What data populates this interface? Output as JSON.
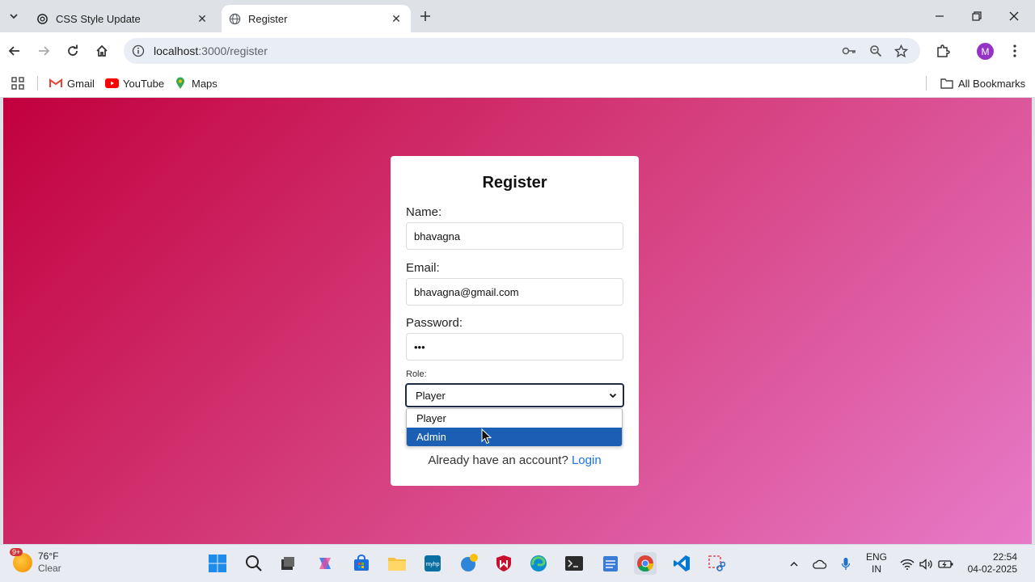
{
  "tabs": [
    {
      "title": "CSS Style Update",
      "active": false
    },
    {
      "title": "Register",
      "active": true
    }
  ],
  "toolbar": {
    "url_host": "localhost",
    "url_path": ":3000/register"
  },
  "profile": {
    "initial": "M"
  },
  "bookmarks": {
    "items": [
      "Gmail",
      "YouTube",
      "Maps"
    ],
    "all_label": "All Bookmarks"
  },
  "form": {
    "title": "Register",
    "name_label": "Name:",
    "name_value": "bhavagna",
    "email_label": "Email:",
    "email_value": "bhavagna@gmail.com",
    "password_label": "Password:",
    "password_value": "•••",
    "role_label": "Role:",
    "role_selected": "Player",
    "role_options": [
      "Player",
      "Admin"
    ],
    "footer_text": "Already have an account?",
    "login_link": "Login"
  },
  "taskbar": {
    "weather_temp": "76°F",
    "weather_desc": "Clear",
    "weather_badge": "9+",
    "lang_line1": "ENG",
    "lang_line2": "IN",
    "time": "22:54",
    "date": "04-02-2025"
  },
  "colors": {
    "gradient_start": "#c2003e",
    "gradient_end": "#e77ac8",
    "selected_option": "#1a5fb4",
    "link": "#1a73e8"
  }
}
